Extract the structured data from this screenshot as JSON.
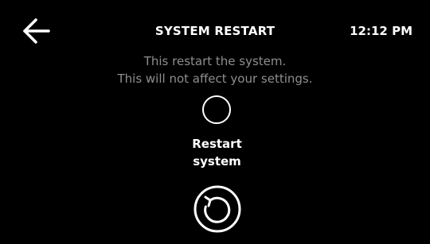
{
  "header": {
    "back_icon": "arrow-left-icon",
    "title": "SYSTEM RESTART",
    "time": "12:12 PM"
  },
  "message": {
    "line1": "This restart the system.",
    "line2": "This will not affect your settings."
  },
  "option": {
    "radio_icon": "radio-circle-icon",
    "label_line1": "Restart",
    "label_line2": "system"
  },
  "action": {
    "restart_icon": "restart-icon"
  },
  "colors": {
    "background": "#000000",
    "text": "#ffffff",
    "muted_text": "#8e8e8e"
  }
}
